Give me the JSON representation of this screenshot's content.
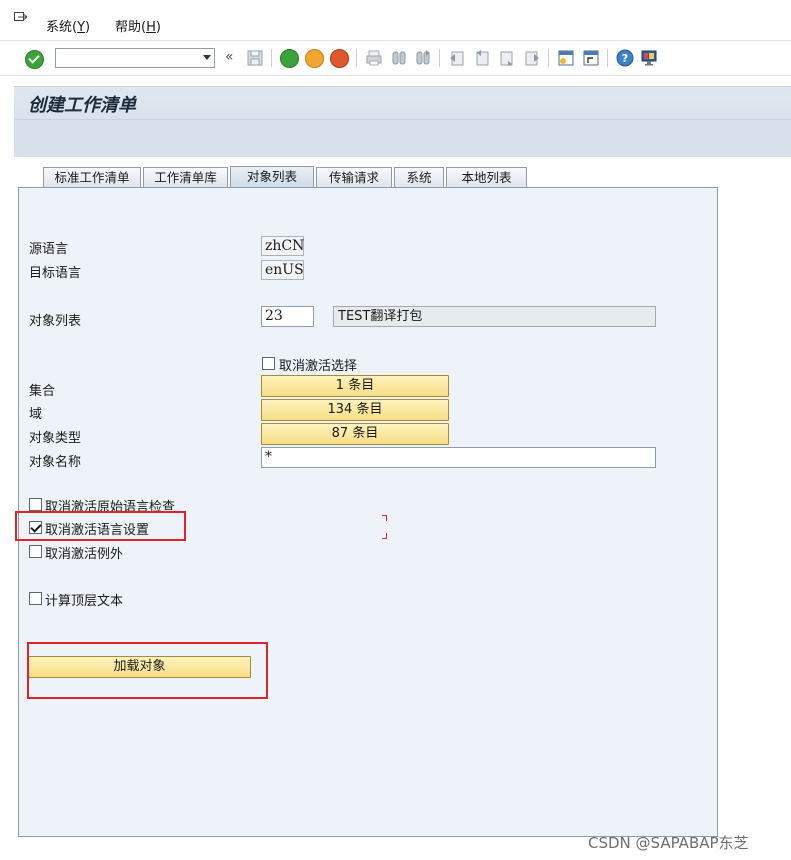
{
  "menu": {
    "items": [
      {
        "label": "系统(",
        "key": "Y",
        "suffix": ")"
      },
      {
        "label": "帮助(",
        "key": "H",
        "suffix": ")"
      }
    ]
  },
  "toolbar": {
    "command_value": "",
    "history_label": "«",
    "icons": [
      "enter-icon",
      "save-icon",
      "back-icon",
      "exit-icon",
      "cancel-icon",
      "print-icon",
      "find-icon",
      "find-next-icon",
      "first-page-icon",
      "previous-page-icon",
      "next-page-icon",
      "last-page-icon",
      "create-session-icon",
      "shortcut-icon",
      "help-icon",
      "customize-layout-icon"
    ]
  },
  "screen": {
    "title": "创建工作清单"
  },
  "tabs": [
    {
      "label": "标准工作清单",
      "active": false
    },
    {
      "label": "工作清单库",
      "active": false
    },
    {
      "label": "对象列表",
      "active": true
    },
    {
      "label": "传输请求",
      "active": false
    },
    {
      "label": "系统",
      "active": false
    },
    {
      "label": "本地列表",
      "active": false
    }
  ],
  "form": {
    "source_language_label": "源语言",
    "source_language_value": "zhCN",
    "target_language_label": "目标语言",
    "target_language_value": "enUS",
    "object_list_label": "对象列表",
    "object_list_value": "23",
    "object_list_desc": "TEST翻译打包",
    "deactivate_selection_label": "取消激活选择",
    "deactivate_selection_checked": false,
    "collection_label": "集合",
    "collection_button": "1 条目",
    "domain_label": "域",
    "domain_button": "134 条目",
    "object_type_label": "对象类型",
    "object_type_button": "87 条目",
    "object_name_label": "对象名称",
    "object_name_value": "*",
    "deactivate_orig_lang_check_label": "取消激活原始语言检查",
    "deactivate_orig_lang_check_checked": false,
    "deactivate_lang_settings_label": "取消激活语言设置",
    "deactivate_lang_settings_checked": true,
    "deactivate_exceptions_label": "取消激活例外",
    "deactivate_exceptions_checked": false,
    "calc_top_level_text_label": "计算顶层文本",
    "calc_top_level_text_checked": false,
    "load_objects_button": "加载对象"
  },
  "watermark": "CSDN @SAPABAP东芝",
  "colors": {
    "accent_red": "#e0222a",
    "button_yellow": "#f6df86",
    "panel_bg": "#edf3f8"
  }
}
